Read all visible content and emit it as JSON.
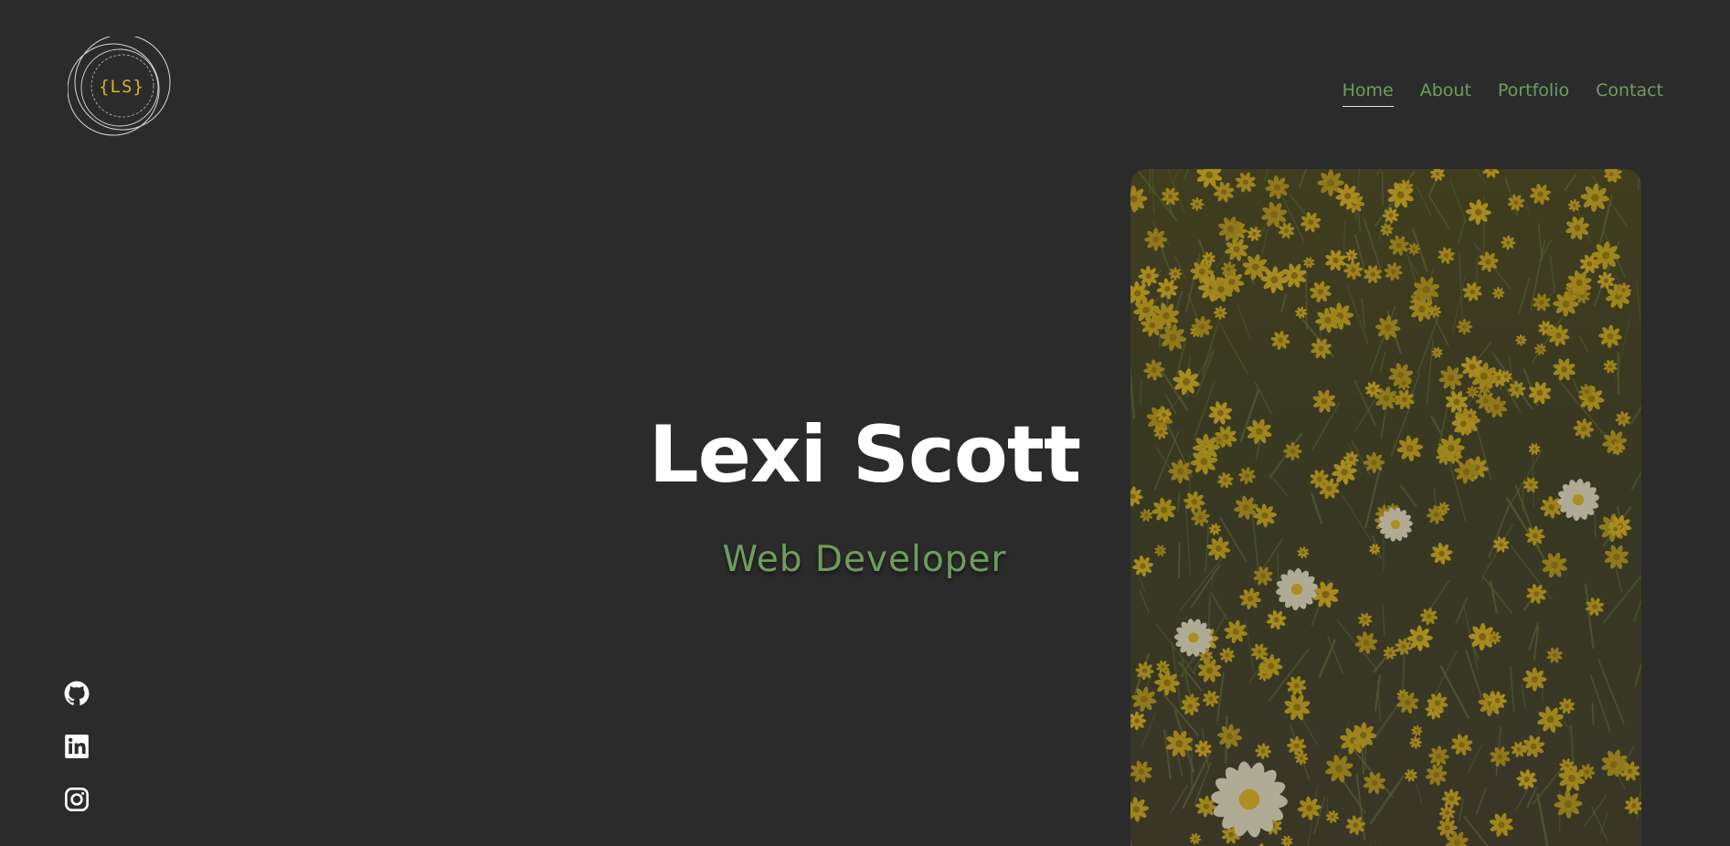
{
  "logo": {
    "text": "{LS}"
  },
  "nav": {
    "items": [
      {
        "label": "Home",
        "active": true
      },
      {
        "label": "About",
        "active": false
      },
      {
        "label": "Portfolio",
        "active": false
      },
      {
        "label": "Contact",
        "active": false
      }
    ]
  },
  "hero": {
    "name": "Lexi Scott",
    "title": "Web Developer"
  },
  "photo": {
    "subject": "field of yellow wildflowers"
  },
  "socials": [
    {
      "icon": "github-icon"
    },
    {
      "icon": "linkedin-icon"
    },
    {
      "icon": "instagram-icon"
    }
  ],
  "colors": {
    "background": "#2b2b2b",
    "accent_green": "#6d9e5c",
    "logo_yellow": "#d9b327",
    "text_white": "#ffffff"
  }
}
